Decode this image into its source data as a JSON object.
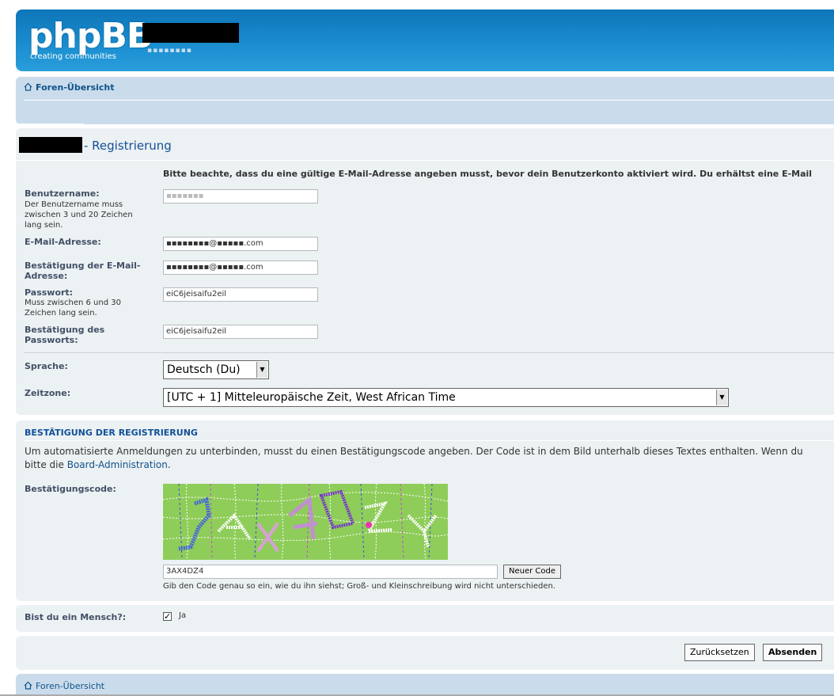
{
  "header": {
    "logo_text": "phpBB",
    "tagline": "creating communities",
    "site_description": "▪▪▪▪▪▪▪▪"
  },
  "nav": {
    "home_label": "Foren-Übersicht"
  },
  "page": {
    "title": "- Registrierung",
    "notice": "Bitte beachte, dass du eine gültige E-Mail-Adresse angeben musst, bevor dein Benutzerkonto aktiviert wird. Du erhältst eine E-Mail"
  },
  "form": {
    "username_label": "Benutzername:",
    "username_explain": [
      "Der Benutzername muss",
      "zwischen 3 und 20 Zeichen",
      "lang sein."
    ],
    "username_value": "▪▪▪▪▪▪▪",
    "email_label": "E-Mail-Adresse:",
    "email_value": "▪▪▪▪▪▪▪▪@▪▪▪▪▪.com",
    "email_confirm_label": [
      "Bestätigung der E-Mail-",
      "Adresse:"
    ],
    "email_confirm_value": "▪▪▪▪▪▪▪▪@▪▪▪▪▪.com",
    "password_label": "Passwort:",
    "password_explain": [
      "Muss zwischen 6 und 30",
      "Zeichen lang sein."
    ],
    "password_value": "eiC6jeisaifu2eil",
    "password_confirm_label": [
      "Bestätigung des",
      "Passworts:"
    ],
    "password_confirm_value": "eiC6jeisaifu2eil",
    "language_label": "Sprache:",
    "language_value": "Deutsch (Du)",
    "timezone_label": "Zeitzone:",
    "timezone_value": "[UTC + 1] Mitteleuropäische Zeit, West African Time"
  },
  "confirm": {
    "heading": "BESTÄTIGUNG DER REGISTRIERUNG",
    "text_line1": "Um automatisierte Anmeldungen zu unterbinden, musst du einen Bestätigungscode angeben. Der Code ist in dem Bild unterhalb dieses Textes enthalten. Wenn du",
    "text_line2_prefix": "bitte die ",
    "text_link": "Board-Administration",
    "text_line2_suffix": ".",
    "code_label": "Bestätigungscode:",
    "code_value": "3AX4DZ4",
    "new_code_button": "Neuer Code",
    "hint": "Gib den Code genau so ein, wie du ihn siehst; Groß- und Kleinschreibung wird nicht unterschieden."
  },
  "human": {
    "label": "Bist du ein Mensch?:",
    "checkbox_label": "Ja",
    "checked": true
  },
  "buttons": {
    "reset": "Zurücksetzen",
    "submit": "Absenden"
  },
  "colors": {
    "header_blue": "#1b8fd0",
    "nav_blue": "#cadceb",
    "panel_bg": "#ecf1f3",
    "link": "#105289",
    "title": "#115098",
    "captcha_green": "#8fcd5a"
  }
}
